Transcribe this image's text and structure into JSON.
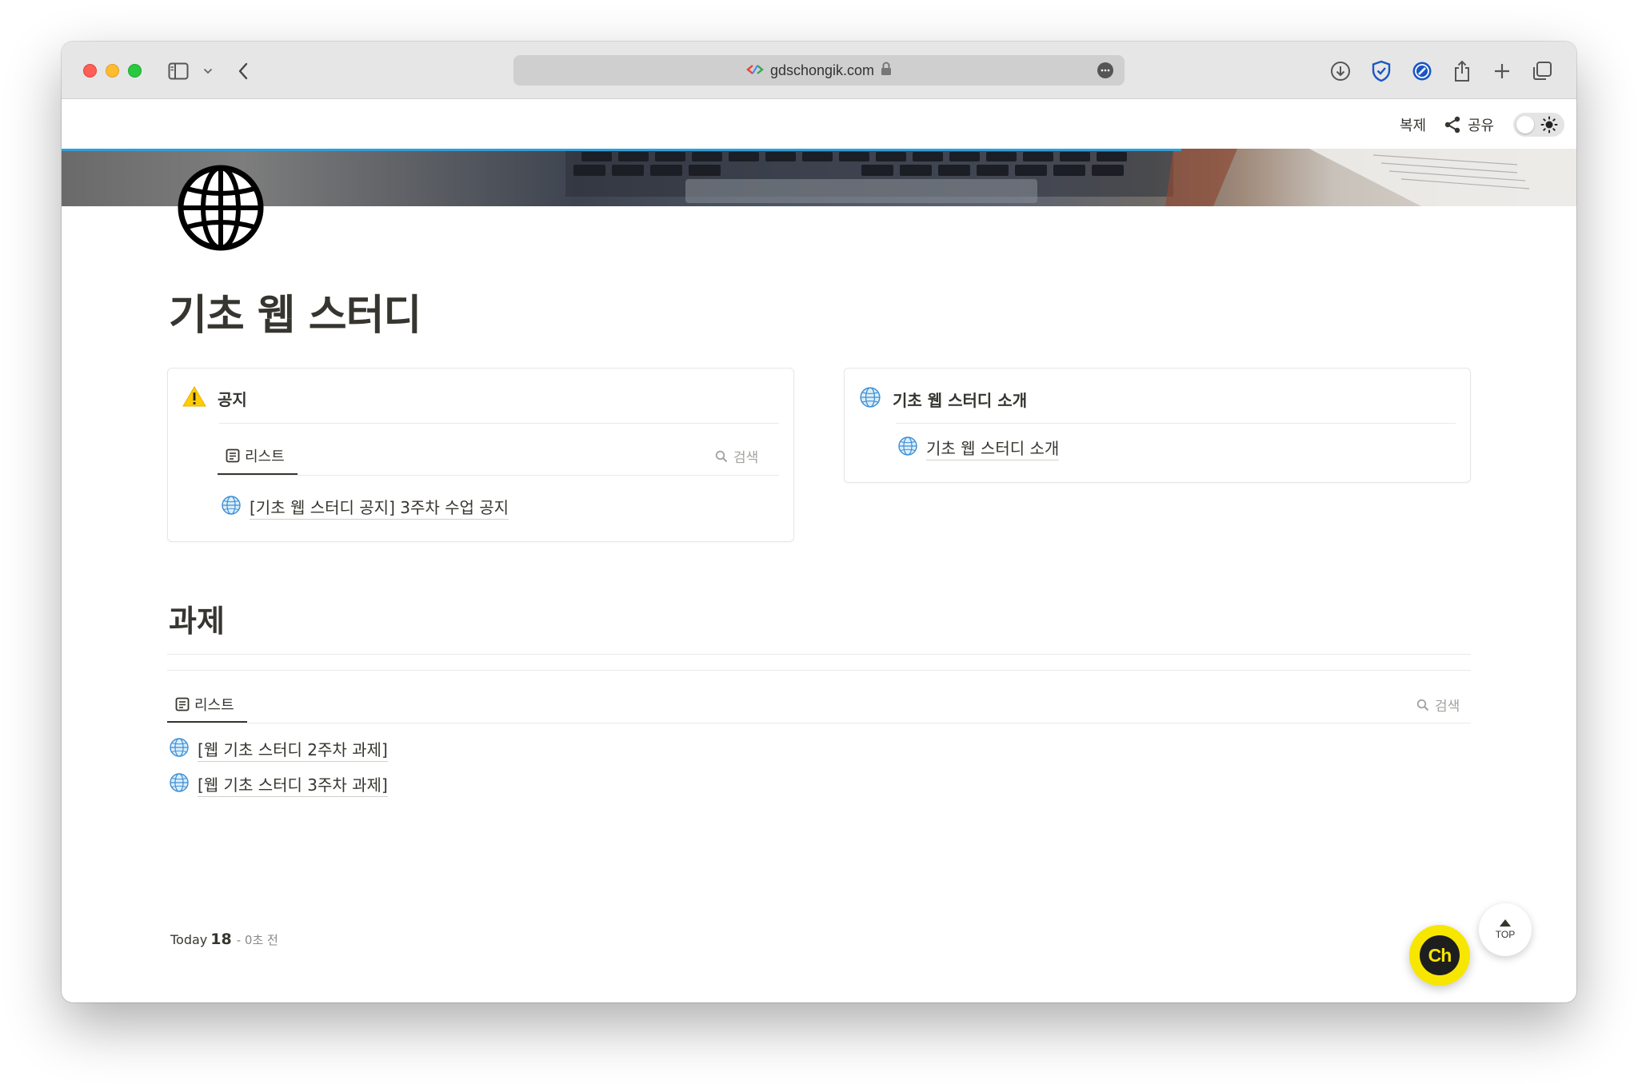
{
  "browser": {
    "url": "gdschongik.com",
    "icons": [
      "sidebar-icon",
      "chevron-down-icon",
      "back-icon",
      "lock-icon",
      "more-icon",
      "download-icon",
      "shield-icon",
      "compass-icon",
      "share-icon",
      "plus-icon",
      "tabs-icon"
    ]
  },
  "topbar": {
    "duplicate_label": "복제",
    "share_label": "공유",
    "theme_toggle": "light"
  },
  "page": {
    "title": "기초 웹 스터디",
    "icon": "globe-icon"
  },
  "notice_card": {
    "title": "공지",
    "icon": "warning-icon",
    "tab_label": "리스트",
    "search_label": "검색",
    "items": [
      "[기초 웹 스터디 공지] 3주차 수업 공지"
    ]
  },
  "intro_card": {
    "title": "기초 웹 스터디 소개",
    "icon": "globe-icon",
    "items": [
      "기초 웹 스터디 소개"
    ]
  },
  "assignments": {
    "title": "과제",
    "tab_label": "리스트",
    "search_label": "검색",
    "items": [
      "[웹 기초 스터디 2주차 과제]",
      "[웹 기초 스터디 3주차 과제]"
    ]
  },
  "footer": {
    "today_label": "Today",
    "today_count": "18",
    "ago": "- 0초 전"
  },
  "floating": {
    "channel_label": "Ch",
    "top_label": "TOP"
  },
  "colors": {
    "accent_loadbar": "#2e9fd8",
    "channel_yellow": "#f7e600",
    "text": "#37352f"
  }
}
